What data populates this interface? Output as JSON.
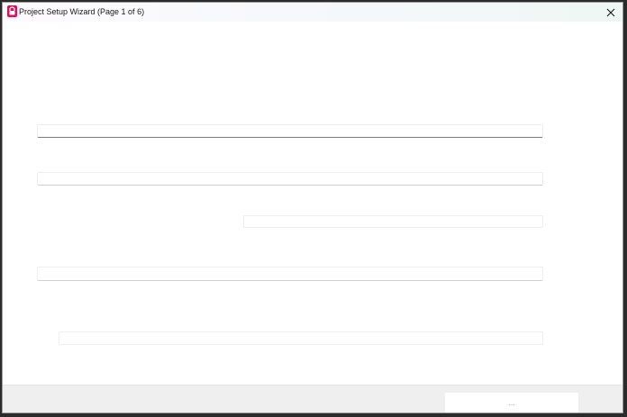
{
  "window": {
    "title": "Project Setup Wizard (Page 1 of 6)",
    "app_icon": "app-logo-icon",
    "close_icon": "close-icon"
  },
  "form": {
    "fields": [
      {
        "value": ""
      },
      {
        "value": ""
      },
      {
        "value": ""
      },
      {
        "value": ""
      },
      {
        "value": ""
      }
    ]
  },
  "footer": {
    "primary_button_label": "..."
  },
  "colors": {
    "accent": "#d4145a",
    "footer_bg": "#efefef"
  }
}
